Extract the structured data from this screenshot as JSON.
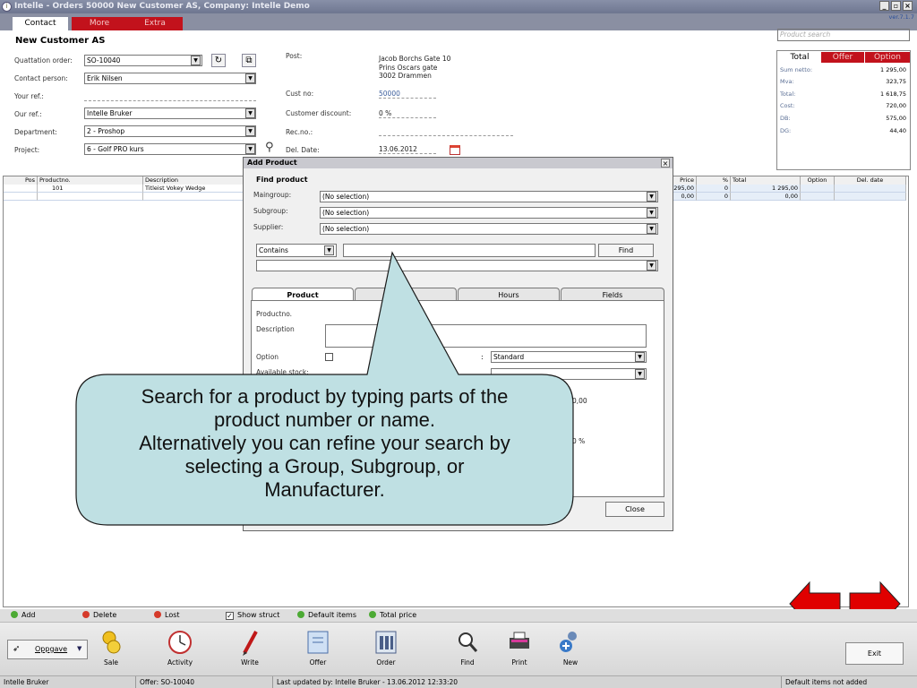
{
  "window": {
    "title": "Intelle - Orders  50000 New Customer AS,  Company: Intelle Demo",
    "version": "ver.7.1.7"
  },
  "tabs": [
    "Contact",
    "More",
    "Extra"
  ],
  "customer": {
    "name": "New Customer AS"
  },
  "fields": {
    "quotation_order": {
      "label": "Quattation order:",
      "value": "SO-10040"
    },
    "contact_person": {
      "label": "Contact person:",
      "value": "Erik Nilsen"
    },
    "your_ref": {
      "label": "Your ref.:",
      "value": ""
    },
    "our_ref": {
      "label": "Our ref.:",
      "value": "Intelle Bruker"
    },
    "department": {
      "label": "Department:",
      "value": "2 - Proshop"
    },
    "project": {
      "label": "Project:",
      "value": "6 - Golf PRO kurs"
    },
    "post": {
      "label": "Post:",
      "lines": [
        "Jacob Borchs Gate 10",
        "Prins Oscars gate",
        "3002 Drammen"
      ]
    },
    "cust_no": {
      "label": "Cust no:",
      "value": "50000"
    },
    "customer_discount": {
      "label": "Customer discount:",
      "value": "0 %"
    },
    "rec_no": {
      "label": "Rec.no.:",
      "value": ""
    },
    "del_date": {
      "label": "Del. Date:",
      "value": "13.06.2012"
    }
  },
  "right_panel": {
    "search_placeholder": "Product search",
    "tabs": [
      "Total",
      "Offer",
      "Option"
    ],
    "rows": [
      {
        "label": "Sum netto:",
        "value": "1 295,00"
      },
      {
        "label": "Mva:",
        "value": "323,75"
      },
      {
        "label": "Total:",
        "value": "1 618,75"
      },
      {
        "label": "Cost:",
        "value": "720,00"
      },
      {
        "label": "DB:",
        "value": "575,00"
      },
      {
        "label": "DG:",
        "value": "44,40"
      }
    ]
  },
  "grid": {
    "left_headers": [
      "Pos",
      "Productno.",
      "Description"
    ],
    "right_headers": [
      "Price",
      "%",
      "Total",
      "Option",
      "Del. date"
    ],
    "rows": [
      {
        "pos": "",
        "productno": "101",
        "description": "Titleist Vokey Wedge",
        "price": "295,00",
        "pct": "0",
        "total": "1 295,00",
        "option": "",
        "del_date": ""
      },
      {
        "pos": "",
        "productno": "",
        "description": "",
        "price": "0,00",
        "pct": "0",
        "total": "0,00",
        "option": "",
        "del_date": ""
      }
    ]
  },
  "dialog": {
    "title": "Add Product",
    "find_heading": "Find product",
    "maingroup": {
      "label": "Maingroup:",
      "value": "(No selection)"
    },
    "subgroup": {
      "label": "Subgroup:",
      "value": "(No selection)"
    },
    "supplier": {
      "label": "Supplier:",
      "value": "(No selection)"
    },
    "match_mode": "Contains",
    "find_button": "Find",
    "tabs": [
      "Product",
      "",
      "Hours",
      "Fields"
    ],
    "productno_label": "Productno.",
    "description_label": "Description",
    "option_label": "Option",
    "available_stock_label": "Available stock:",
    "price_type_value": "Standard",
    "partial_values": [
      "0,00",
      "0 %"
    ],
    "close_button": "Close"
  },
  "callout": {
    "lines": [
      "Search for a product by typing parts of the",
      "product number or name.",
      "Alternatively you can refine your search by",
      "selecting a Group, Subgroup, or",
      "Manufacturer."
    ]
  },
  "bottom_toolbar": {
    "add": "Add",
    "delete": "Delete",
    "lost": "Lost",
    "show_struct": "Show struct",
    "default_items": "Default items",
    "total_price": "Total price"
  },
  "actions": {
    "oppgave": "Oppgave",
    "items": [
      "Sale",
      "Activity",
      "Write",
      "Offer",
      "Order",
      "Find",
      "Print",
      "New"
    ],
    "exit": "Exit"
  },
  "status": {
    "user": "Intelle Bruker",
    "offer": "Offer: SO-10040",
    "last_updated": "Last updated by: Intelle Bruker - 13.06.2012 12:33:20",
    "message": "Default items not added"
  },
  "colors": {
    "tab_red": "#c2121c",
    "callout_fill": "#bfe0e3",
    "nav_arrow": "#e00000"
  }
}
